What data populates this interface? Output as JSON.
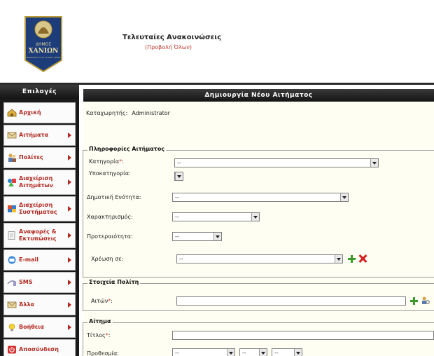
{
  "header": {
    "logo": {
      "label_line1": "ΔΗΜΟΣ",
      "label_line2": "ΧΑΝΙΩΝ",
      "label_line3": "MUNICIPALITY OF CHANIA CRETE"
    },
    "announcements_title": "Τελευταίες Ανακοινώσεις",
    "announcements_link": "(Προβολή Όλων)"
  },
  "sidebar": {
    "title": "Επιλογές",
    "items": [
      {
        "label": "Αρχική",
        "icon": "home-icon",
        "arrow": false
      },
      {
        "label": "Αιτήματα",
        "icon": "envelope-icon",
        "arrow": true
      },
      {
        "label": "Πολίτες",
        "icon": "people-icon",
        "arrow": true
      },
      {
        "label": "Διαχείριση Αιτημάτων",
        "icon": "shapes-icon",
        "arrow": true
      },
      {
        "label": "Διαχείριση Συστήματος",
        "icon": "chart-icon",
        "arrow": true
      },
      {
        "label": "Αναφορές & Εκτυπώσεις",
        "icon": "document-icon",
        "arrow": true
      },
      {
        "label": "E-mail",
        "icon": "email-icon",
        "arrow": true
      },
      {
        "label": "SMS",
        "icon": "phone-icon",
        "arrow": true
      },
      {
        "label": "Άλλα",
        "icon": "envelope-icon",
        "arrow": true
      },
      {
        "label": "Βοήθεια",
        "icon": "lightbulb-icon",
        "arrow": true
      },
      {
        "label": "Αποσύνδεση",
        "icon": "power-icon",
        "arrow": false
      }
    ]
  },
  "main": {
    "title": "Δημιουργία Νέου Αιτήματος",
    "creator_label": "Καταχωρητής:",
    "creator_value": "Administrator",
    "request_info": {
      "legend": "Πληροφορίες Αιτήματος",
      "category_label": "Κατηγορία",
      "category_value": "--",
      "subcategory_label": "Υποκατηγορία:",
      "municipal_unit_label": "Δημοτική Ενότητα:",
      "municipal_unit_value": "--",
      "characterization_label": "Χαρακτηρισμός:",
      "characterization_value": "--",
      "priority_label": "Προτεραιότητα:",
      "priority_value": "--",
      "assign_label": "Χρέωση σε:",
      "assign_value": "--"
    },
    "citizen": {
      "legend": "Στοιχεία Πολίτη",
      "applicant_label": "Αιτών"
    },
    "request": {
      "legend": "Αίτημα",
      "title_label": "Τίτλος",
      "deadline_label": "Προθεσμία:",
      "deadline_day": "--",
      "deadline_month": "--",
      "deadline_year": "--"
    },
    "required_mark": "*",
    "colon": ":"
  },
  "colors": {
    "accent": "#b1281f",
    "panel_bg": "#fffef2",
    "bar_dark": "#1a1a1a"
  }
}
